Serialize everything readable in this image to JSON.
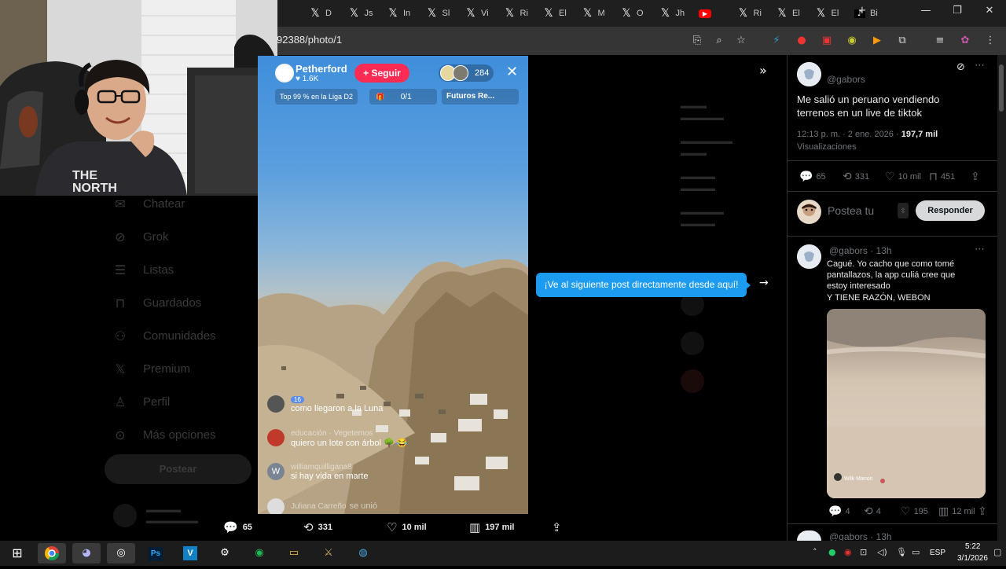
{
  "browser": {
    "tabs": [
      {
        "label": "D",
        "icon": "x-icon"
      },
      {
        "label": "Js",
        "icon": "x-icon"
      },
      {
        "label": "In",
        "icon": "x-icon"
      },
      {
        "label": "Sl",
        "icon": "x-icon"
      },
      {
        "label": "Vi",
        "icon": "x-icon"
      },
      {
        "label": "Ri",
        "icon": "x-icon"
      },
      {
        "label": "El",
        "icon": "x-icon"
      },
      {
        "label": "M",
        "icon": "x-icon"
      },
      {
        "label": "O",
        "icon": "x-icon"
      },
      {
        "label": "Jh",
        "icon": "x-icon"
      },
      {
        "label": "",
        "icon": "youtube-icon"
      },
      {
        "label": "Ri",
        "icon": "x-icon"
      },
      {
        "label": "El",
        "icon": "x-icon"
      },
      {
        "label": "El",
        "icon": "x-icon"
      },
      {
        "label": "Bi",
        "icon": "tiktok-icon"
      }
    ],
    "new_tab": "+",
    "url": "92388/photo/1"
  },
  "nav": {
    "items": [
      {
        "label": "Chatear",
        "icon": "chat-icon"
      },
      {
        "label": "Grok",
        "icon": "grok-icon"
      },
      {
        "label": "Listas",
        "icon": "list-icon"
      },
      {
        "label": "Guardados",
        "icon": "bookmark-icon"
      },
      {
        "label": "Comunidades",
        "icon": "community-icon"
      },
      {
        "label": "Premium",
        "icon": "x-icon"
      },
      {
        "label": "Perfil",
        "icon": "person-icon"
      },
      {
        "label": "Más opciones",
        "icon": "more-icon"
      }
    ],
    "post_button": "Postear"
  },
  "live": {
    "streamer": "Petherford",
    "likes": "♥ 1.6K",
    "follow": "+ Seguir",
    "viewers": "284",
    "rank": "Top 99 % en la Liga D2",
    "goal": "0/1",
    "future": "Futuros Re...",
    "chat": [
      {
        "user": "16",
        "text": "como llegaron a la Luna",
        "avatar_color": "#555"
      },
      {
        "user": "educación · Vegetemos",
        "text": "quiero un  lote  con árbol 🌳 😂",
        "avatar_color": "#c0392b"
      },
      {
        "user": "williamquilligana8",
        "text": "si hay vida en marte",
        "avatar_color": "#7a8594",
        "initial": "W"
      },
      {
        "user": "Juliana Carreño",
        "text": "se unió",
        "avatar_color": "#ddd"
      }
    ]
  },
  "video_actions": {
    "replies": "65",
    "reposts": "331",
    "likes": "10 mil",
    "views": "197 mil"
  },
  "tooltip": "¡Ve al siguiente post directamente desde aquí!",
  "post": {
    "handle": "@gabors",
    "text_line1": "Me salió un peruano vendiendo",
    "text_line2": "terrenos en un live de tiktok",
    "time": "12:13 p. m. · 2 ene. 2026 · ",
    "views_count": "197,7 mil",
    "views_label": "Visualizaciones",
    "replies": "65",
    "reposts": "331",
    "likes": "10 mil",
    "bookmarks": "451"
  },
  "reply_box": {
    "placeholder": "Postea tu",
    "button": "Responder"
  },
  "reply": {
    "handle": "@gabors · 13h",
    "line1": "Cagué. Yo cacho que como tomé",
    "line2": "pantallazos, la app culiá cree que",
    "line3": "estoy interesado",
    "line4": "Y TIENE RAZÓN, WEBON",
    "photo_caption": "Wilk Manon",
    "replies": "4",
    "reposts": "4",
    "likes": "195",
    "views": "12 mil"
  },
  "next_reply": {
    "handle": "@gabors · 13h"
  },
  "taskbar": {
    "lang": "ESP",
    "time": "5:22",
    "date": "3/1/2026"
  }
}
